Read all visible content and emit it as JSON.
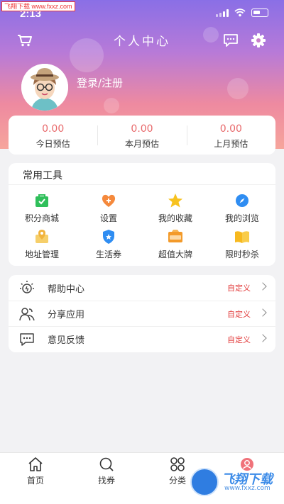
{
  "watermark": "飞翔下载 www.fxxz.com",
  "status": {
    "time": "2:13"
  },
  "header": {
    "title": "个人中心",
    "login_text": "登录/注册"
  },
  "stats": [
    {
      "value": "0.00",
      "label": "今日预估"
    },
    {
      "value": "0.00",
      "label": "本月预估"
    },
    {
      "value": "0.00",
      "label": "上月预估"
    }
  ],
  "tools": {
    "title": "常用工具",
    "items": [
      {
        "label": "积分商城",
        "icon": "points-mall-icon",
        "color": "#2fbf5a"
      },
      {
        "label": "设置",
        "icon": "settings-icon",
        "color": "#f5893c"
      },
      {
        "label": "我的收藏",
        "icon": "favorites-star-icon",
        "color": "#f7c21f"
      },
      {
        "label": "我的浏览",
        "icon": "browse-compass-icon",
        "color": "#2f8df2"
      },
      {
        "label": "地址管理",
        "icon": "address-pin-icon",
        "color": "#f1b33c"
      },
      {
        "label": "生活券",
        "icon": "coupon-shield-icon",
        "color": "#2f8df2"
      },
      {
        "label": "超值大牌",
        "icon": "brand-sale-icon",
        "color": "#f39a2a"
      },
      {
        "label": "限时秒杀",
        "icon": "flash-sale-book-icon",
        "color": "#f7b91f"
      }
    ]
  },
  "menu": {
    "items": [
      {
        "label": "帮助中心",
        "right": "自定义",
        "icon": "help-bulb-icon"
      },
      {
        "label": "分享应用",
        "right": "自定义",
        "icon": "share-users-icon"
      },
      {
        "label": "意见反馈",
        "right": "自定义",
        "icon": "feedback-chat-icon"
      }
    ]
  },
  "tabbar": {
    "items": [
      {
        "label": "首页",
        "icon": "home-icon"
      },
      {
        "label": "找券",
        "icon": "search-coupon-icon"
      },
      {
        "label": "分类",
        "icon": "category-icon"
      },
      {
        "label": "",
        "icon": "profile-icon"
      }
    ]
  },
  "site_logo": {
    "name": "飞翔下载",
    "url": "www.fxxz.com"
  },
  "colors": {
    "accent": "#e8696b",
    "custom_text": "#e23b3b"
  }
}
